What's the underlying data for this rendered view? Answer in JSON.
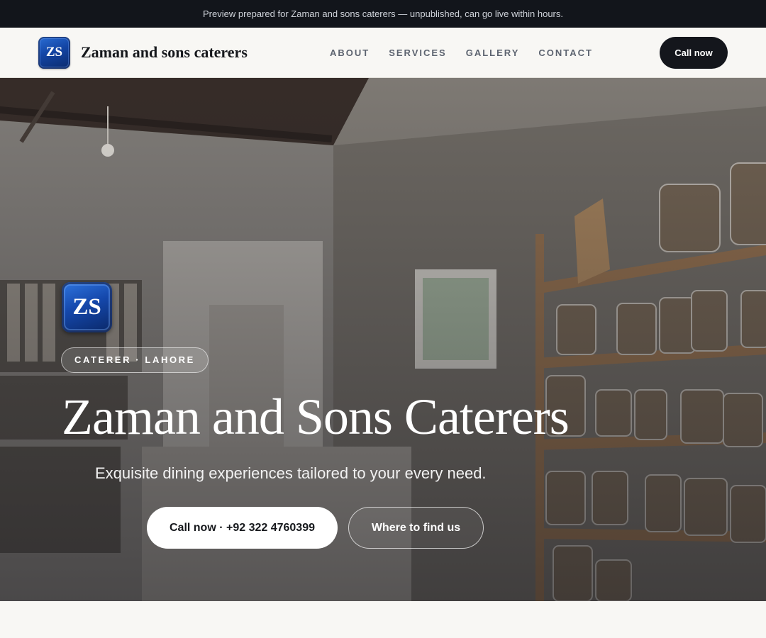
{
  "preview_bar": {
    "text": "Preview prepared for Zaman and sons caterers — unpublished, can go live within hours."
  },
  "header": {
    "logo_text": "ZS",
    "brand_name": "Zaman and sons caterers",
    "nav": [
      {
        "label": "ABOUT"
      },
      {
        "label": "SERVICES"
      },
      {
        "label": "GALLERY"
      },
      {
        "label": "CONTACT"
      }
    ],
    "call_button": "Call now"
  },
  "hero": {
    "logo_text": "ZS",
    "tag": "CATERER · LAHORE",
    "title": "Zaman and Sons Caterers",
    "subtitle": "Exquisite dining experiences tailored to your every need.",
    "primary_button": "Call now · +92 322 4760399",
    "secondary_button": "Where to find us"
  },
  "colors": {
    "dark": "#12151b",
    "brand_blue": "#1548ac",
    "page_bg": "#f8f7f4"
  }
}
